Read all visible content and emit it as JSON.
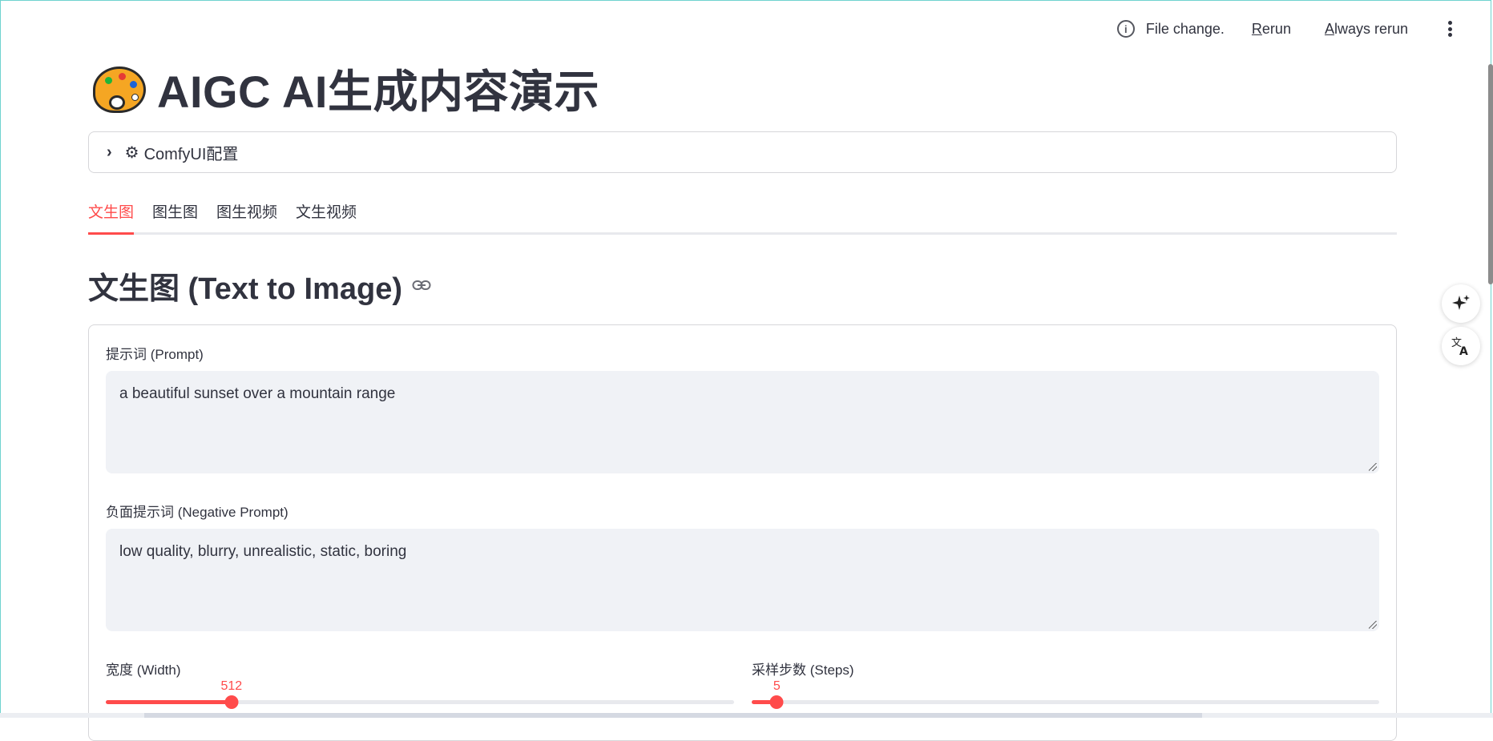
{
  "toolbar": {
    "status": "File change.",
    "rerun_label": "Rerun",
    "always_rerun_label": "Always rerun"
  },
  "header": {
    "title": "AIGC AI生成内容演示"
  },
  "expander": {
    "label": "ComfyUI配置"
  },
  "tabs": [
    {
      "label": "文生图",
      "active": true
    },
    {
      "label": "图生图",
      "active": false
    },
    {
      "label": "图生视频",
      "active": false
    },
    {
      "label": "文生视频",
      "active": false
    }
  ],
  "section": {
    "heading": "文生图 (Text to Image)"
  },
  "form": {
    "prompt_label": "提示词 (Prompt)",
    "prompt_value": "a beautiful sunset over a mountain range",
    "negative_label": "负面提示词 (Negative Prompt)",
    "negative_value": "low quality, blurry, unrealistic, static, boring",
    "width_label": "宽度 (Width)",
    "width_value": "512",
    "width_fraction": 0.2,
    "steps_label": "采样步数 (Steps)",
    "steps_value": "5",
    "steps_fraction": 0.04
  },
  "colors": {
    "accent": "#ff4b4b",
    "text": "#31333f",
    "input_bg": "#f0f2f6"
  },
  "icons": {
    "info": "info-icon",
    "menu": "more-vertical-icon",
    "sparkle": "sparkle-icon",
    "translate": "translate-icon",
    "link": "link-icon",
    "chevron": "chevron-right-icon",
    "gear": "gear-icon",
    "palette": "palette-emoji-icon"
  }
}
